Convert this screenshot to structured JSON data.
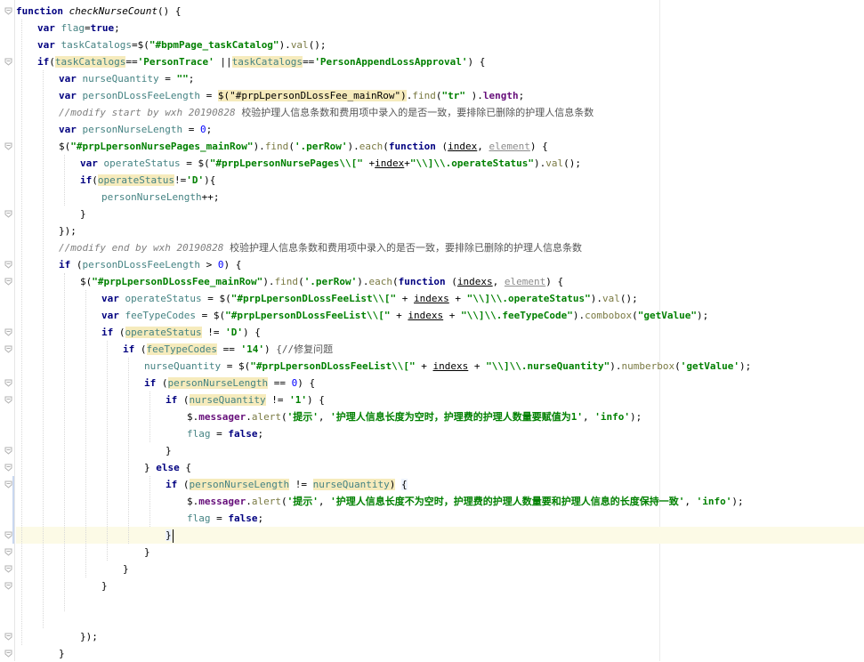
{
  "editor": {
    "lines": [
      {
        "indent": 0,
        "parts": [
          [
            "kw",
            "function "
          ],
          [
            "fn",
            "checkNurseCount"
          ],
          [
            "",
            "() {"
          ]
        ]
      },
      {
        "indent": 1,
        "parts": [
          [
            "kw",
            "var "
          ],
          [
            "ident",
            "flag"
          ],
          [
            "",
            "="
          ],
          [
            "kw",
            "true"
          ],
          [
            "",
            ";"
          ]
        ]
      },
      {
        "indent": 1,
        "parts": [
          [
            "kw",
            "var "
          ],
          [
            "ident",
            "taskCatalogs"
          ],
          [
            "",
            "=$("
          ],
          [
            "str",
            "\"#bpmPage_taskCatalog\""
          ],
          [
            "",
            ")."
          ],
          [
            "call",
            "val"
          ],
          [
            "",
            "();"
          ]
        ]
      },
      {
        "indent": 1,
        "parts": [
          [
            "kw",
            "if"
          ],
          [
            "",
            "("
          ],
          [
            "hl ident",
            "taskCatalogs"
          ],
          [
            "",
            "=="
          ],
          [
            "str",
            "'PersonTrace'"
          ],
          [
            "",
            " ||"
          ],
          [
            "hl ident",
            "taskCatalogs"
          ],
          [
            "",
            "=="
          ],
          [
            "str",
            "'PersonAppendLossApproval'"
          ],
          [
            "",
            ") {"
          ]
        ]
      },
      {
        "indent": 2,
        "parts": [
          [
            "kw",
            "var "
          ],
          [
            "ident",
            "nurseQuantity"
          ],
          [
            "",
            " = "
          ],
          [
            "str",
            "\"\""
          ],
          [
            "",
            ";"
          ]
        ]
      },
      {
        "indent": 2,
        "parts": [
          [
            "kw",
            "var "
          ],
          [
            "ident",
            "personDLossFeeLength"
          ],
          [
            "",
            " = "
          ],
          [
            "hl",
            "$(\"#prpLpersonDLossFee_mainRow\")"
          ],
          [
            "",
            "."
          ],
          [
            "call",
            "find"
          ],
          [
            "",
            "("
          ],
          [
            "str",
            "\"tr\""
          ],
          [
            "",
            " )."
          ],
          [
            "field bold",
            "length"
          ],
          [
            "",
            ";"
          ]
        ]
      },
      {
        "indent": 2,
        "parts": [
          [
            "cmt",
            "//modify start by wxh 20190828 "
          ],
          [
            "cmt-cn",
            "校验护理人信息条数和费用项中录入的是否一致，要排除已删除的护理人信息条数"
          ]
        ]
      },
      {
        "indent": 2,
        "parts": [
          [
            "kw",
            "var "
          ],
          [
            "ident",
            "personNurseLength"
          ],
          [
            "",
            " = "
          ],
          [
            "num",
            "0"
          ],
          [
            "",
            ";"
          ]
        ]
      },
      {
        "indent": 2,
        "parts": [
          [
            "",
            "$("
          ],
          [
            "str",
            "\"#prpLpersonNursePages_mainRow\""
          ],
          [
            "",
            ")."
          ],
          [
            "call",
            "find"
          ],
          [
            "",
            "("
          ],
          [
            "str",
            "'.perRow'"
          ],
          [
            "",
            ")."
          ],
          [
            "call",
            "each"
          ],
          [
            "",
            "("
          ],
          [
            "kw",
            "function "
          ],
          [
            "",
            "("
          ],
          [
            "underline",
            "index"
          ],
          [
            ",",
            ", "
          ],
          [
            "underline gray",
            "element"
          ],
          [
            "",
            ") {"
          ]
        ]
      },
      {
        "indent": 3,
        "parts": [
          [
            "kw",
            "var "
          ],
          [
            "ident",
            "operateStatus"
          ],
          [
            "",
            " = $("
          ],
          [
            "str",
            "\"#prpLpersonNursePages\\\\[\""
          ],
          [
            "",
            " +"
          ],
          [
            "underline",
            "index"
          ],
          [
            "",
            "+"
          ],
          [
            "str",
            "\"\\\\]\\\\.operateStatus\""
          ],
          [
            "",
            ")."
          ],
          [
            "call",
            "val"
          ],
          [
            "",
            "();"
          ]
        ]
      },
      {
        "indent": 3,
        "parts": [
          [
            "kw",
            "if"
          ],
          [
            "",
            "("
          ],
          [
            "hl ident",
            "operateStatus"
          ],
          [
            "",
            "!="
          ],
          [
            "str",
            "'D'"
          ],
          [
            "",
            ")"
          ],
          [
            "",
            "{"
          ]
        ]
      },
      {
        "indent": 4,
        "parts": [
          [
            "ident",
            "personNurseLength"
          ],
          [
            "",
            "++;"
          ]
        ]
      },
      {
        "indent": 3,
        "parts": [
          [
            "",
            "}"
          ]
        ]
      },
      {
        "indent": 2,
        "parts": [
          [
            "",
            "});"
          ]
        ]
      },
      {
        "indent": 2,
        "parts": [
          [
            "cmt",
            "//modify end by wxh 20190828 "
          ],
          [
            "cmt-cn",
            "校验护理人信息条数和费用项中录入的是否一致，要排除已删除的护理人信息条数"
          ]
        ]
      },
      {
        "indent": 2,
        "parts": [
          [
            "kw",
            "if "
          ],
          [
            "",
            "("
          ],
          [
            "ident",
            "personDLossFeeLength"
          ],
          [
            "",
            " > "
          ],
          [
            "num",
            "0"
          ],
          [
            "",
            ") {"
          ]
        ]
      },
      {
        "indent": 3,
        "parts": [
          [
            "",
            "$("
          ],
          [
            "str",
            "\"#prpLpersonDLossFee_mainRow\""
          ],
          [
            "",
            ")."
          ],
          [
            "call",
            "find"
          ],
          [
            "",
            "("
          ],
          [
            "str",
            "'.perRow'"
          ],
          [
            "",
            ")."
          ],
          [
            "call",
            "each"
          ],
          [
            "",
            "("
          ],
          [
            "kw",
            "function "
          ],
          [
            "",
            "("
          ],
          [
            "underline",
            "indexs"
          ],
          [
            "",
            ", "
          ],
          [
            "underline gray",
            "element"
          ],
          [
            "",
            ") {"
          ]
        ]
      },
      {
        "indent": 4,
        "parts": [
          [
            "kw",
            "var "
          ],
          [
            "ident",
            "operateStatus"
          ],
          [
            "",
            " = $("
          ],
          [
            "str",
            "\"#prpLpersonDLossFeeList\\\\[\""
          ],
          [
            "",
            " + "
          ],
          [
            "underline",
            "indexs"
          ],
          [
            "",
            " + "
          ],
          [
            "str",
            "\"\\\\]\\\\.operateStatus\""
          ],
          [
            "",
            ")."
          ],
          [
            "call",
            "val"
          ],
          [
            "",
            "();"
          ]
        ]
      },
      {
        "indent": 4,
        "parts": [
          [
            "kw",
            "var "
          ],
          [
            "ident",
            "feeTypeCodes"
          ],
          [
            "",
            " = $("
          ],
          [
            "str",
            "\"#prpLpersonDLossFeeList\\\\[\""
          ],
          [
            "",
            " + "
          ],
          [
            "underline",
            "indexs"
          ],
          [
            "",
            " + "
          ],
          [
            "str",
            "\"\\\\]\\\\.feeTypeCode\""
          ],
          [
            "",
            ")."
          ],
          [
            "call",
            "combobox"
          ],
          [
            "",
            "("
          ],
          [
            "str",
            "\"getValue\""
          ],
          [
            "",
            ");"
          ]
        ]
      },
      {
        "indent": 4,
        "parts": [
          [
            "kw",
            "if "
          ],
          [
            "",
            "("
          ],
          [
            "hl ident",
            "operateStatus"
          ],
          [
            "",
            " != "
          ],
          [
            "str",
            "'D'"
          ],
          [
            "",
            ") {"
          ]
        ]
      },
      {
        "indent": 5,
        "parts": [
          [
            "kw",
            "if "
          ],
          [
            "",
            "("
          ],
          [
            "hl ident",
            "feeTypeCodes"
          ],
          [
            "",
            " == "
          ],
          [
            "str",
            "'14'"
          ],
          [
            "",
            ") "
          ],
          [
            "cmt-cn",
            "{//修复问题"
          ]
        ]
      },
      {
        "indent": 6,
        "parts": [
          [
            "ident",
            "nurseQuantity"
          ],
          [
            "",
            " = $("
          ],
          [
            "str",
            "\"#prpLpersonDLossFeeList\\\\[\""
          ],
          [
            "",
            " + "
          ],
          [
            "underline",
            "indexs"
          ],
          [
            "",
            " + "
          ],
          [
            "str",
            "\"\\\\]\\\\.nurseQuantity\""
          ],
          [
            "",
            ")."
          ],
          [
            "call",
            "numberbox"
          ],
          [
            "",
            "("
          ],
          [
            "str",
            "'getValue'"
          ],
          [
            "",
            ");"
          ]
        ]
      },
      {
        "indent": 6,
        "parts": [
          [
            "kw",
            "if "
          ],
          [
            "",
            "("
          ],
          [
            "hl ident",
            "personNurseLength"
          ],
          [
            "",
            " == "
          ],
          [
            "num",
            "0"
          ],
          [
            "",
            ") {"
          ]
        ]
      },
      {
        "indent": 7,
        "parts": [
          [
            "kw",
            "if "
          ],
          [
            "",
            "("
          ],
          [
            "hl ident",
            "nurseQuantity"
          ],
          [
            "",
            " != "
          ],
          [
            "str",
            "'1'"
          ],
          [
            "",
            ") {"
          ]
        ]
      },
      {
        "indent": 8,
        "parts": [
          [
            "",
            "$."
          ],
          [
            "field bold",
            "messager"
          ],
          [
            "",
            "."
          ],
          [
            "call",
            "alert"
          ],
          [
            "",
            "("
          ],
          [
            "str",
            "'提示'"
          ],
          [
            "",
            ", "
          ],
          [
            "str",
            "'护理人信息长度为空时，护理费的护理人数量要赋值为1'"
          ],
          [
            "",
            ", "
          ],
          [
            "str",
            "'info'"
          ],
          [
            "",
            ");"
          ]
        ]
      },
      {
        "indent": 8,
        "parts": [
          [
            "ident",
            "flag"
          ],
          [
            "",
            " = "
          ],
          [
            "kw",
            "false"
          ],
          [
            "",
            ";"
          ]
        ]
      },
      {
        "indent": 7,
        "parts": [
          [
            "",
            "}"
          ]
        ]
      },
      {
        "indent": 6,
        "parts": [
          [
            "",
            "} "
          ],
          [
            "kw",
            "else "
          ],
          [
            "",
            "{"
          ]
        ]
      },
      {
        "indent": 7,
        "parts": [
          [
            "kw",
            "if "
          ],
          [
            "",
            "("
          ],
          [
            "hl ident",
            "personNurseLength"
          ],
          [
            "",
            " != "
          ],
          [
            "hl ident",
            "nurseQuantity"
          ],
          [
            "hl",
            ")"
          ],
          [
            "",
            " "
          ],
          [
            "hl2",
            "{"
          ]
        ]
      },
      {
        "indent": 8,
        "parts": [
          [
            "",
            "$."
          ],
          [
            "field bold",
            "messager"
          ],
          [
            "",
            "."
          ],
          [
            "call",
            "alert"
          ],
          [
            "",
            "("
          ],
          [
            "str",
            "'提示'"
          ],
          [
            "",
            ", "
          ],
          [
            "str",
            "'护理人信息长度不为空时，护理费的护理人数量要和护理人信息的长度保持一致'"
          ],
          [
            "",
            ", "
          ],
          [
            "str",
            "'info'"
          ],
          [
            "",
            ");"
          ]
        ]
      },
      {
        "indent": 8,
        "parts": [
          [
            "ident",
            "flag"
          ],
          [
            "",
            " = "
          ],
          [
            "kw",
            "false"
          ],
          [
            "",
            ";"
          ]
        ]
      },
      {
        "indent": 7,
        "parts": [
          [
            "hl2",
            "}"
          ],
          [
            "caret",
            ""
          ]
        ],
        "current": true
      },
      {
        "indent": 6,
        "parts": [
          [
            "",
            "}"
          ]
        ]
      },
      {
        "indent": 5,
        "parts": [
          [
            "",
            "}"
          ]
        ]
      },
      {
        "indent": 4,
        "parts": [
          [
            "",
            "}"
          ]
        ]
      },
      {
        "indent": 0,
        "parts": [
          [
            "",
            ""
          ]
        ]
      },
      {
        "indent": 0,
        "parts": [
          [
            "",
            ""
          ]
        ]
      },
      {
        "indent": 3,
        "parts": [
          [
            "",
            "});"
          ]
        ]
      },
      {
        "indent": 2,
        "parts": [
          [
            "",
            "}"
          ]
        ]
      }
    ]
  }
}
